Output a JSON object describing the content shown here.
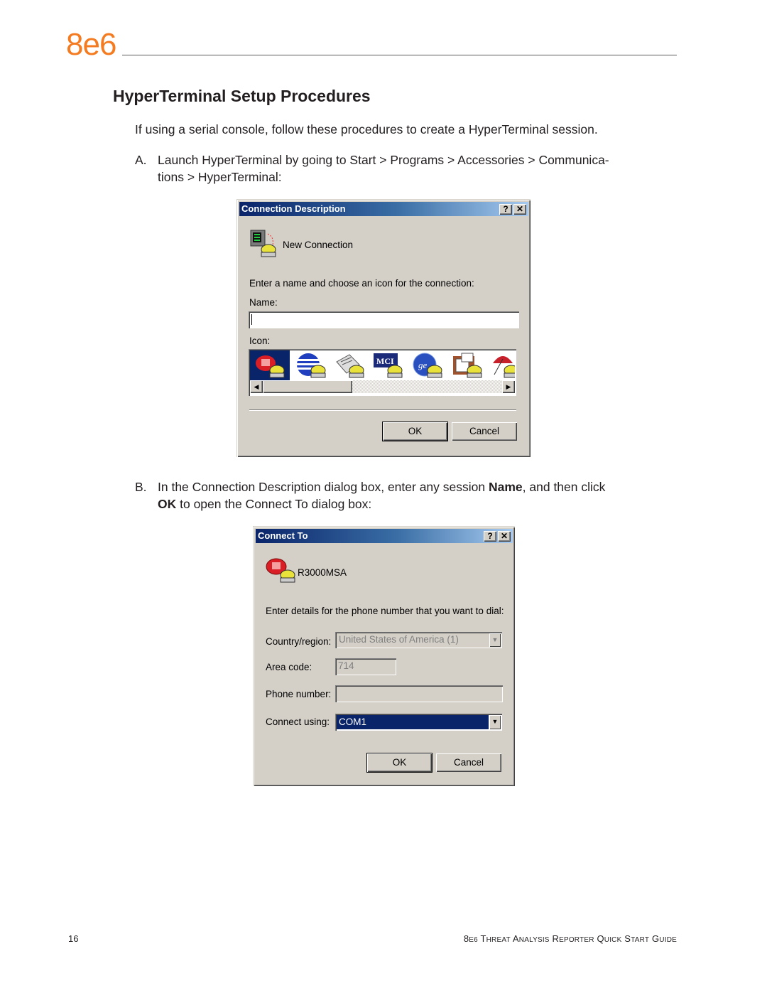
{
  "header": {
    "logo": "8e6"
  },
  "section_title": "HyperTerminal Setup Procedures",
  "intro": "If using a serial console, follow these procedures to create a HyperTerminal session.",
  "steps": [
    {
      "label": "A.",
      "text": "Launch HyperTerminal by going to Start > Programs > Accessories > Communica-tions > HyperTerminal:"
    },
    {
      "label": "B.",
      "text_before": "In the Connection Description dialog box, enter any session ",
      "bold1": "Name",
      "text_mid": ", and then click ",
      "bold2": "OK",
      "text_after": " to open the Connect To dialog box:"
    }
  ],
  "dialog1": {
    "title": "Connection Description",
    "help_glyph": "?",
    "close_glyph": "✕",
    "connection_name": "New Connection",
    "instruction": "Enter a name and choose an icon for the connection:",
    "name_label": "Name:",
    "name_value": "",
    "icon_label": "Icon:",
    "icons": [
      "red-phone-icon",
      "globe-stripes-icon",
      "newspaper-icon",
      "mci-icon",
      "ge-icon",
      "documents-icon",
      "umbrella-icon"
    ],
    "icons_text": [
      "",
      "",
      "",
      "MCI",
      "",
      "",
      ""
    ],
    "scroll_left": "◀",
    "scroll_right": "▶",
    "ok_label": "OK",
    "cancel_label": "Cancel"
  },
  "dialog2": {
    "title": "Connect To",
    "help_glyph": "?",
    "close_glyph": "✕",
    "connection_name": "R3000MSA",
    "instruction": "Enter details for the phone number that you want to dial:",
    "country_label": "Country/region:",
    "country_value": "United States of America (1)",
    "area_label": "Area code:",
    "area_value": "714",
    "phone_label": "Phone number:",
    "phone_value": "",
    "connect_label": "Connect using:",
    "connect_value": "COM1",
    "dropdown_glyph": "▼",
    "ok_label": "OK",
    "cancel_label": "Cancel"
  },
  "footer": {
    "page_number": "16",
    "guide_title": "8e6 Threat Analysis Reporter Quick Start Guide"
  },
  "colors": {
    "brand_orange": "#f47b20",
    "titlebar_dark": "#0a246a",
    "titlebar_light": "#a6caf0",
    "dialog_face": "#d4d0c8",
    "selection": "#0a246a"
  }
}
